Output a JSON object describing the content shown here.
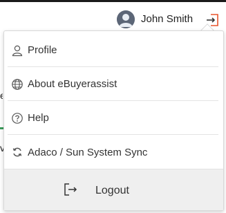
{
  "header": {
    "user_name": "John Smith",
    "accent_color": "#e8532b"
  },
  "menu": {
    "items": [
      {
        "label": "Profile",
        "icon": "user-icon"
      },
      {
        "label": "About eBuyerassist",
        "icon": "globe-icon"
      },
      {
        "label": "Help",
        "icon": "question-circle-icon"
      },
      {
        "label": "Adaco / Sun System Sync",
        "icon": "sync-icon"
      }
    ],
    "logout": {
      "label": "Logout",
      "icon": "logout-icon"
    }
  }
}
